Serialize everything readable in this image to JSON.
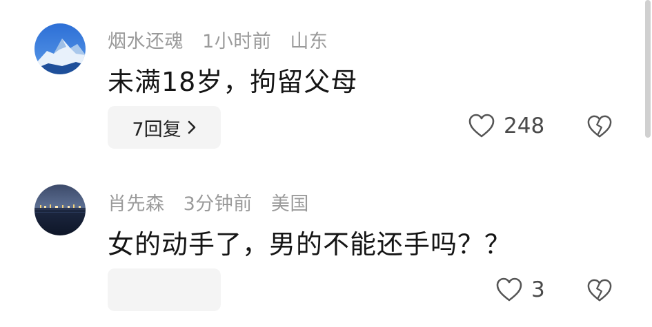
{
  "comments": [
    {
      "username": "烟水还魂",
      "time": "1小时前",
      "location": "山东",
      "text": "未满18岁，拘留父母",
      "reply_label": "7回复",
      "likes": "248"
    },
    {
      "username": "肖先森",
      "time": "3分钟前",
      "location": "美国",
      "text": "女的动手了，男的不能还手吗？？",
      "reply_label": "",
      "likes": "3"
    }
  ],
  "colors": {
    "meta": "#9a9a9a",
    "text": "#151515",
    "reply_bg": "#f4f4f4",
    "icon": "#555555"
  },
  "icons": {
    "like": "heart-icon",
    "dislike": "broken-heart-icon",
    "chevron": "chevron-right-icon"
  }
}
